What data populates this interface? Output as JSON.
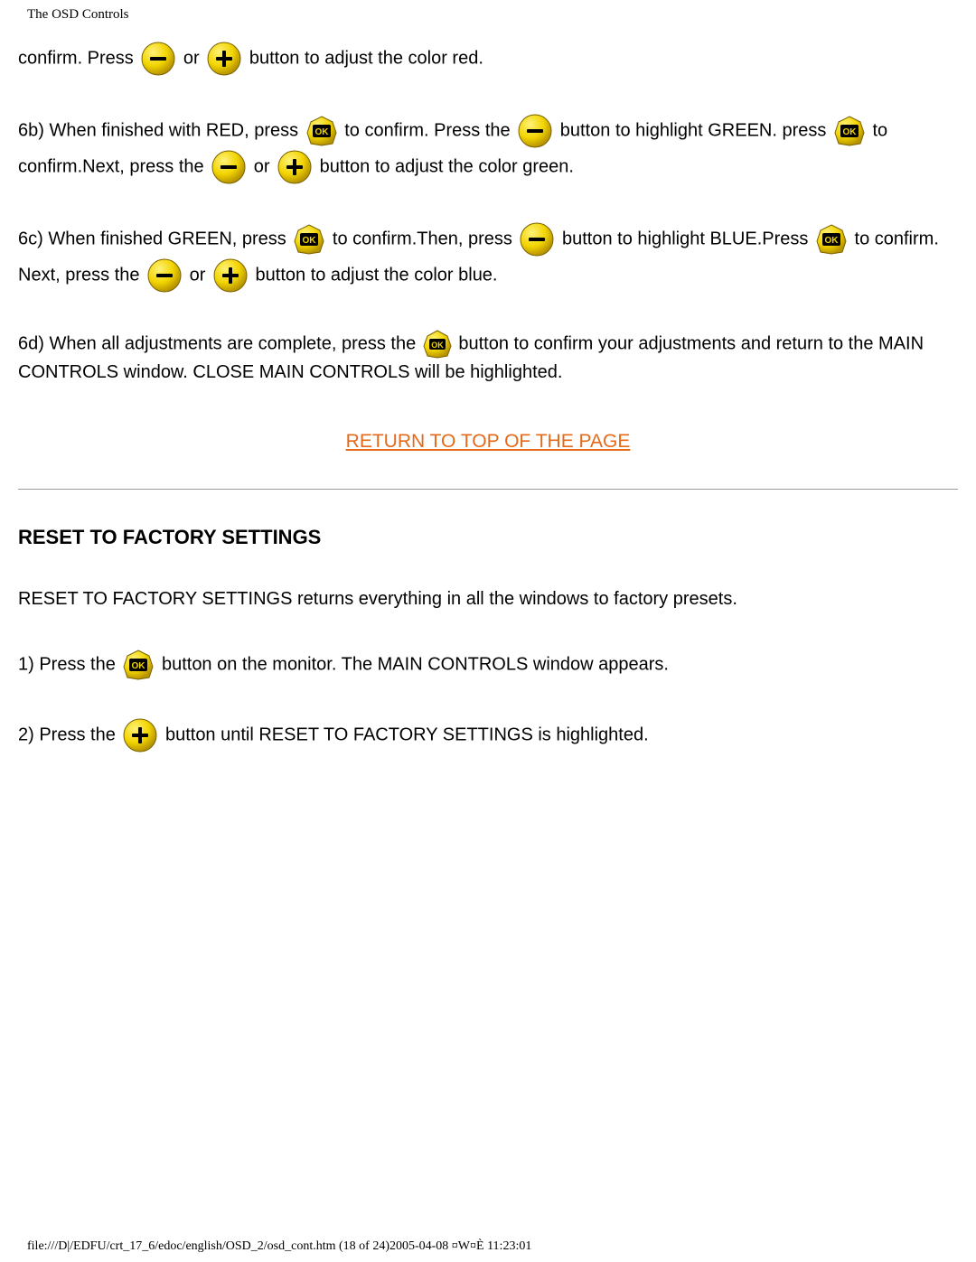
{
  "header": "The OSD Controls",
  "p1": {
    "t1": "confirm. Press ",
    "t2": " or ",
    "t3": "  button to adjust the color red."
  },
  "p2": {
    "t1": "6b) When finished with RED, press ",
    "t2": "  to confirm. Press the ",
    "t3": " button to highlight GREEN. press ",
    "t4": "  to confirm.Next, press the ",
    "t5": " or ",
    "t6": "  button to adjust the color green."
  },
  "p3": {
    "t1": "6c) When finished GREEN, press ",
    "t2": "  to confirm.Then, press ",
    "t3": " button to highlight BLUE.Press ",
    "t4": "  to confirm. Next, press the ",
    "t5": " or ",
    "t6": "  button to adjust the color blue."
  },
  "p4": {
    "t1": "6d) When all adjustments are complete, press the ",
    "t2": " button to confirm your adjustments and return to the MAIN CONTROLS window. CLOSE MAIN CONTROLS will be highlighted."
  },
  "return_link": "RETURN TO TOP OF THE PAGE",
  "section_heading": "RESET TO FACTORY SETTINGS",
  "p5": "RESET TO FACTORY SETTINGS returns everything in all the windows to factory presets.",
  "p6": {
    "t1": "1) Press the ",
    "t2": "  button on the monitor. The MAIN CONTROLS window appears."
  },
  "p7": {
    "t1": "2) Press the ",
    "t2": " button until RESET TO FACTORY SETTINGS is highlighted."
  },
  "footer": "file:///D|/EDFU/crt_17_6/edoc/english/OSD_2/osd_cont.htm (18 of 24)2005-04-08 ¤W¤È 11:23:01"
}
